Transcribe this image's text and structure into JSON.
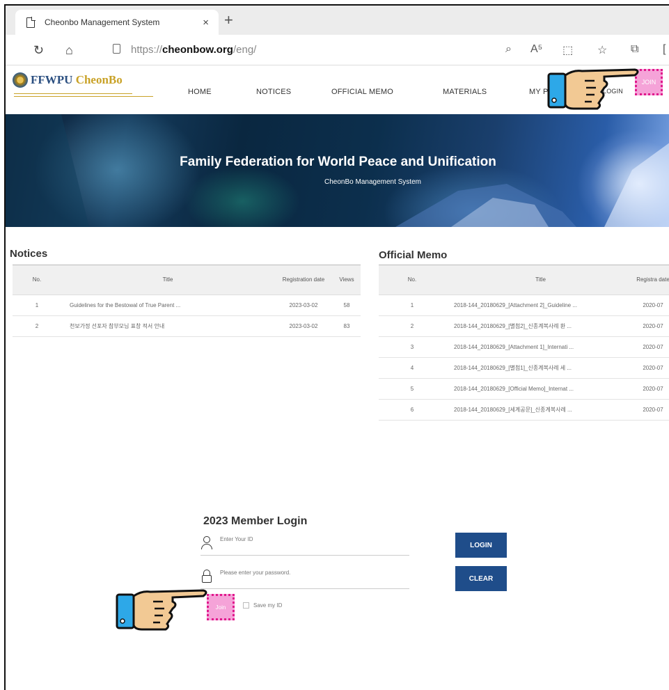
{
  "browser": {
    "tab_title": "Cheonbo Management System",
    "tab_close": "×",
    "new_tab": "+",
    "url_prefix": "https://",
    "url_domain": "cheonbow.org",
    "url_path": "/eng/"
  },
  "site": {
    "logo_main": "FFWPU",
    "logo_accent": "CheonBo",
    "menu": [
      "HOME",
      "NOTICES",
      "OFFICIAL MEMO",
      "MATERIALS",
      "MY P",
      "LOGIN"
    ],
    "join_label": "JOIN"
  },
  "banner": {
    "title": "Family Federation for World Peace and Unification",
    "subtitle": "CheonBo Management System"
  },
  "notices": {
    "title": "Notices",
    "columns": [
      "No.",
      "Title",
      "Registration date",
      "Views"
    ],
    "rows": [
      [
        "1",
        "Guidelines for the Bestowal of True Parent ...",
        "2023-03-02",
        "58"
      ],
      [
        "2",
        "천보가정 선포자 참부모님 표창 적서 안내",
        "2023-03-02",
        "83"
      ]
    ]
  },
  "memo": {
    "title": "Official Memo",
    "columns": [
      "No.",
      "Title",
      "Registra date"
    ],
    "rows": [
      [
        "1",
        "2018-144_20180629_[Attachment 2]_Guideline ...",
        "2020-07"
      ],
      [
        "2",
        "2018-144_20180629_[별첨2]_신종계복사례 환 ...",
        "2020-07"
      ],
      [
        "3",
        "2018-144_20180629_[Attachment 1]_Internati ...",
        "2020-07"
      ],
      [
        "4",
        "2018-144_20180629_[별첨1]_신종계복사례 세 ...",
        "2020-07"
      ],
      [
        "5",
        "2018-144_20180629_[Official Memo]_Internat ...",
        "2020-07"
      ],
      [
        "6",
        "2018-144_20180629_[세계공문]_신종계복사례 ...",
        "2020-07"
      ]
    ]
  },
  "login": {
    "title": "2023 Member Login",
    "id_placeholder": "Enter Your ID",
    "pw_placeholder": "Please enter your password.",
    "login_button": "LOGIN",
    "clear_button": "CLEAR",
    "join_label": "Join",
    "save_id": "Save my ID"
  },
  "colors": {
    "primary_button": "#1f4d8a",
    "highlight": "#f5a3d8",
    "highlight_border": "#e0188c",
    "cuff": "#2da8e8"
  }
}
